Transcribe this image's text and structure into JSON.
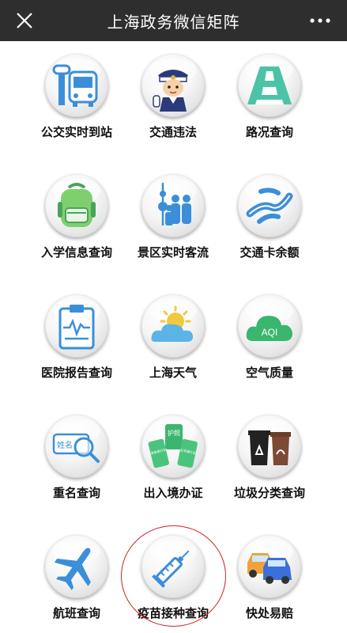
{
  "header": {
    "title": "上海政务微信矩阵",
    "close_icon": "close-icon",
    "more_icon": "more-icon"
  },
  "tiles": [
    {
      "label": "公交实时到站",
      "icon": "bus-icon"
    },
    {
      "label": "交通违法",
      "icon": "traffic-police-icon"
    },
    {
      "label": "路况查询",
      "icon": "road-icon"
    },
    {
      "label": "入学信息查询",
      "icon": "backpack-icon"
    },
    {
      "label": "景区实时客流",
      "icon": "crowd-tower-icon"
    },
    {
      "label": "交通卡余额",
      "icon": "transit-card-icon"
    },
    {
      "label": "医院报告查询",
      "icon": "medical-report-icon"
    },
    {
      "label": "上海天气",
      "icon": "weather-icon"
    },
    {
      "label": "空气质量",
      "icon": "aqi-cloud-icon"
    },
    {
      "label": "重名查询",
      "icon": "name-search-icon"
    },
    {
      "label": "出入境办证",
      "icon": "passport-icon"
    },
    {
      "label": "垃圾分类查询",
      "icon": "trash-bins-icon"
    },
    {
      "label": "航班查询",
      "icon": "airplane-icon"
    },
    {
      "label": "疫苗接种查询",
      "icon": "syringe-icon"
    },
    {
      "label": "快处易赔",
      "icon": "cars-icon"
    }
  ],
  "icon_text": {
    "aqi": "AQI",
    "name_tag": "姓名",
    "passport": "护照",
    "permit_left": "港澳通行证",
    "permit_right": "台湾通行证"
  },
  "colors": {
    "titlebar": "#2e2e2e",
    "blue": "#3b8fd9",
    "green": "#3ab66f",
    "teal": "#4cc3a7",
    "highlight": "#d42020"
  }
}
